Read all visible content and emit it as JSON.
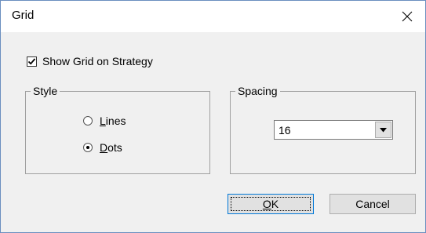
{
  "window": {
    "title": "Grid",
    "close_icon": "close-icon"
  },
  "show_grid": {
    "label": "Show Grid on Strategy",
    "checked": true
  },
  "style_group": {
    "legend": "Style",
    "options": [
      {
        "label": "Lines",
        "mnemonic": "L",
        "rest": "ines",
        "checked": false
      },
      {
        "label": "Dots",
        "mnemonic": "D",
        "rest": "ots",
        "checked": true
      }
    ]
  },
  "spacing_group": {
    "legend": "Spacing",
    "selected_value": "16",
    "dropdown_icon": "chevron-down-icon"
  },
  "buttons": {
    "ok": {
      "label": "OK",
      "mnemonic": "O",
      "rest": "K"
    },
    "cancel": {
      "label": "Cancel"
    }
  }
}
